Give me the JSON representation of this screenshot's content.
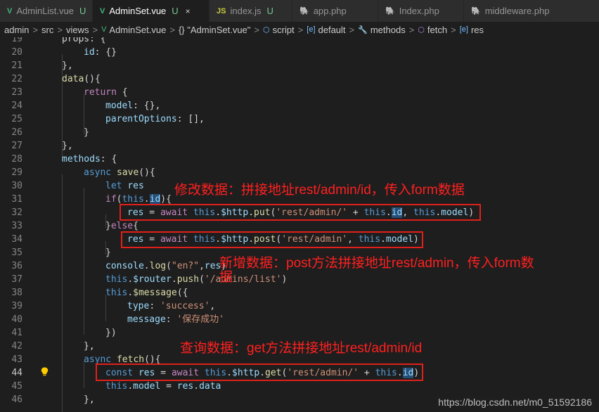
{
  "tabs": [
    {
      "name": "AdminList.vue",
      "status": "U",
      "icon": "vue-icon",
      "glyph": "V"
    },
    {
      "name": "AdminSet.vue",
      "status": "U",
      "icon": "vue-icon",
      "glyph": "V",
      "close": "×"
    },
    {
      "name": "index.js",
      "status": "U",
      "icon": "js-icon",
      "glyph": "JS"
    },
    {
      "name": "app.php",
      "status": "",
      "icon": "php-icon",
      "glyph": "🐘"
    },
    {
      "name": "Index.php",
      "status": "",
      "icon": "php-icon",
      "glyph": "🐘"
    },
    {
      "name": "middleware.php",
      "status": "",
      "icon": "php-icon",
      "glyph": "🐘"
    }
  ],
  "breadcrumb": {
    "parts": [
      "admin",
      "src",
      "views"
    ],
    "file": "AdminSet.vue",
    "component": "{} \"AdminSet.vue\"",
    "script": "script",
    "default": "default",
    "methods": "methods",
    "fetch": "fetch",
    "res": "res",
    "sep": ">"
  },
  "line_numbers": [
    "19",
    "20",
    "21",
    "22",
    "23",
    "24",
    "25",
    "26",
    "27",
    "28",
    "29",
    "30",
    "31",
    "32",
    "33",
    "34",
    "35",
    "36",
    "37",
    "38",
    "39",
    "40",
    "41",
    "42",
    "43",
    "44",
    "45",
    "46"
  ],
  "current_line": "44",
  "code": {
    "l19": "props: {",
    "l20a": "id",
    "l20b": ": {}",
    "l21": "},",
    "l22a": "data",
    "l22b": "(){",
    "l23a": "return",
    "l23b": " {",
    "l24a": "model",
    "l24b": ": {},",
    "l25a": "parentOptions",
    "l25b": ": [],",
    "l26": "}",
    "l27": "},",
    "l28a": "methods",
    "l28b": ": {",
    "l29a": "async",
    "l29b": "save",
    "l29c": "(){",
    "l30a": "let",
    "l30b": "res",
    "l31a": "if",
    "l31b": "(",
    "l31c": "this",
    "l31d": ".",
    "l31e": "id",
    "l31f": "){",
    "l32a": "res",
    "l32b": " = ",
    "l32c": "await",
    "l32d": "this",
    "l32e": ".",
    "l32f": "$http",
    "l32g": ".",
    "l32h": "put",
    "l32i": "(",
    "l32j": "'rest/admin/'",
    "l32k": " + ",
    "l32l": "this",
    "l32m": ".",
    "l32n": "id",
    "l32o": ", ",
    "l32p": "this",
    "l32q": ".",
    "l32r": "model",
    "l32s": ")",
    "l33a": "}",
    "l33b": "else",
    "l33c": "{",
    "l34a": "res",
    "l34b": " = ",
    "l34c": "await",
    "l34d": "this",
    "l34e": ".",
    "l34f": "$http",
    "l34g": ".",
    "l34h": "post",
    "l34i": "(",
    "l34j": "'rest/admin'",
    "l34k": ", ",
    "l34l": "this",
    "l34m": ".",
    "l34n": "model",
    "l34o": ")",
    "l35": "}",
    "l36a": "console",
    "l36b": ".",
    "l36c": "log",
    "l36d": "(",
    "l36e": "\"en?\"",
    "l36f": ",",
    "l36g": "res",
    "l36h": ")",
    "l37a": "this",
    "l37b": ".",
    "l37c": "$router",
    "l37d": ".",
    "l37e": "push",
    "l37f": "(",
    "l37g": "'/admins/list'",
    "l37h": ")",
    "l38a": "this",
    "l38b": ".",
    "l38c": "$message",
    "l38d": "({",
    "l39a": "type",
    "l39b": ": ",
    "l39c": "'success'",
    "l39d": ",",
    "l40a": "message",
    "l40b": ": ",
    "l40c": "'保存成功'",
    "l41": "})",
    "l42": "},",
    "l43a": "async",
    "l43b": "fetch",
    "l43c": "(){",
    "l44a": "const",
    "l44b": "res",
    "l44c": " = ",
    "l44d": "await",
    "l44e": "this",
    "l44f": ".",
    "l44g": "$http",
    "l44h": ".",
    "l44i": "get",
    "l44j": "(",
    "l44k": "'rest/admin/'",
    "l44l": " + ",
    "l44m": "this",
    "l44n": ".",
    "l44o": "id",
    "l44p": ")",
    "l45a": "this",
    "l45b": ".",
    "l45c": "model",
    "l45d": " = ",
    "l45e": "res",
    "l45f": ".",
    "l45g": "data",
    "l46": "},"
  },
  "annotations": {
    "edit": "修改数据：拼接地址rest/admin/id，传入form数据",
    "add_line1": "新增数据：post方法拼接地址rest/admin，传入form数",
    "add_line2": "据",
    "query": "查询数据：get方法拼接地址rest/admin/id"
  },
  "watermark": "https://blog.csdn.net/m0_51592186",
  "colors": {
    "annotation": "#ff2020",
    "box": "#e0201a",
    "keyword": "#c586c0",
    "storage": "#569cd6",
    "function": "#dcdcaa",
    "variable": "#9cdcfe",
    "string": "#ce9178"
  }
}
